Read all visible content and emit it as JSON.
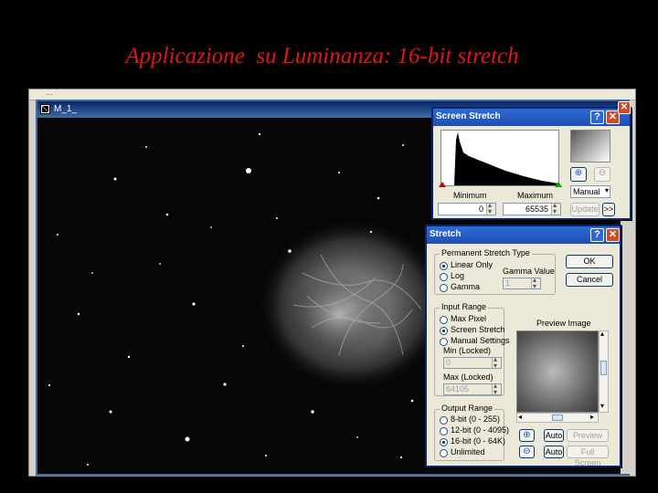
{
  "slide": {
    "title": "Applicazione  su Luminanza: 16-bit stretch"
  },
  "app": {
    "topline_text": "..."
  },
  "image_window": {
    "title": "M_1_"
  },
  "screen_stretch": {
    "title": "Screen Stretch",
    "help": "?",
    "close": "✕",
    "minimum_label": "Minimum",
    "maximum_label": "Maximum",
    "minimum_value": "0",
    "maximum_value": "65535",
    "mode_select": "Manual",
    "update_label": "Update",
    "more_label": ">>",
    "zoom_in_icon": "zoom-in-icon",
    "zoom_out_icon": "zoom-out-icon"
  },
  "stretch": {
    "title": "Stretch",
    "help": "?",
    "close": "✕",
    "ok_label": "OK",
    "cancel_label": "Cancel",
    "stretch_type": {
      "label": "Permanent Stretch Type",
      "options": [
        "Linear Only",
        "Log",
        "Gamma"
      ],
      "selected": "Linear Only",
      "gamma_label": "Gamma Value",
      "gamma_value": "1"
    },
    "input_range": {
      "label": "Input Range",
      "options": [
        "Max Pixel",
        "Screen Stretch",
        "Manual Settings"
      ],
      "selected": "Screen Stretch",
      "min_label": "Min (Locked)",
      "min_value": "0",
      "max_label": "Max (Locked)",
      "max_value": "64105"
    },
    "output_range": {
      "label": "Output Range",
      "options": [
        "8-bit (0 - 255)",
        "12-bit (0 - 4095)",
        "16-bit (0 - 64K)",
        "Unlimited"
      ],
      "selected": "16-bit (0 - 64K)"
    },
    "preview_label": "Preview Image",
    "auto_label_1": "Auto",
    "auto_label_2": "Auto",
    "preview_button": "Preview",
    "fullscreen_button": "Full Screen"
  },
  "colors": {
    "title_red": "#e11616",
    "xp_blue": "#2d6bd8",
    "close_red": "#d04a2a",
    "dialog_bg": "#ece9d8"
  }
}
